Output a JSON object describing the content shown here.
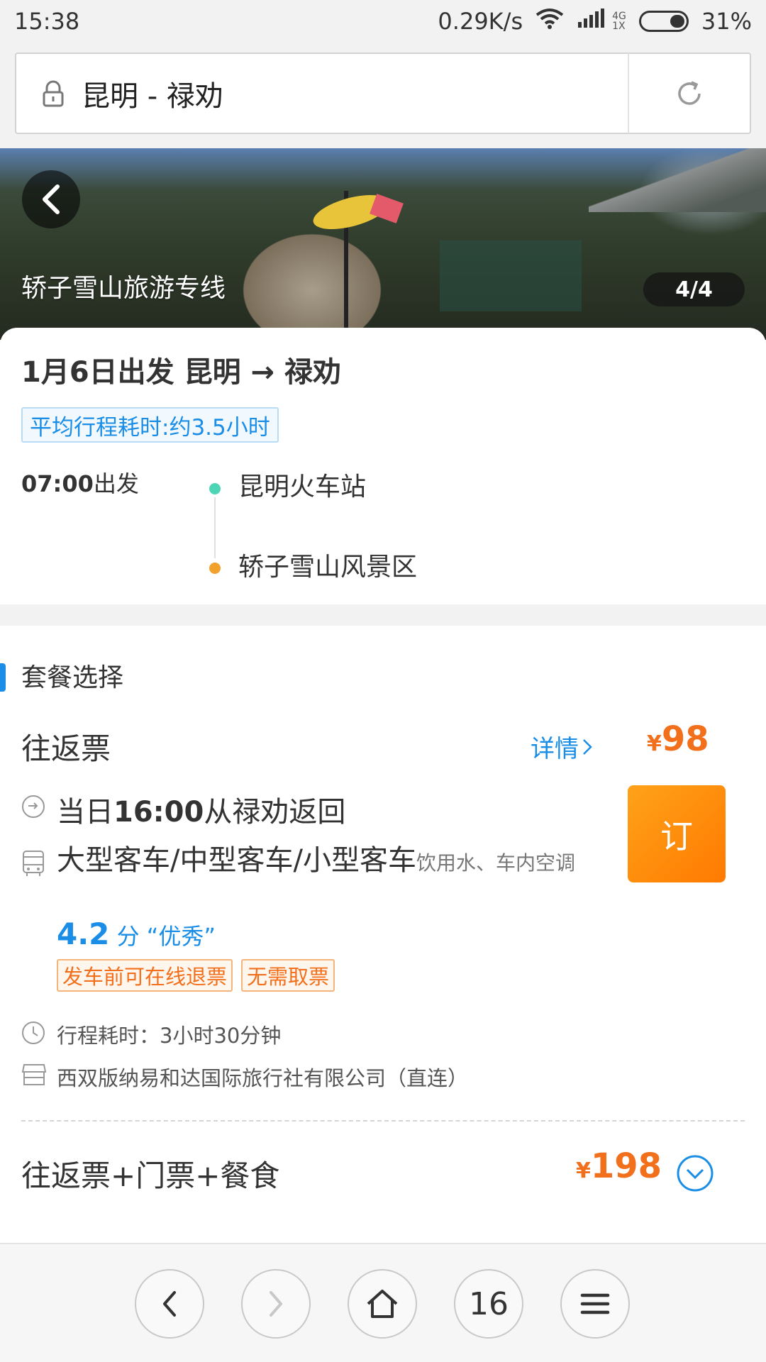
{
  "status_bar": {
    "time": "15:38",
    "network_speed": "0.29K/s",
    "signal_top": "4G",
    "signal_bottom": "1X",
    "battery": "31%"
  },
  "url_bar": {
    "title": "昆明 - 禄劝"
  },
  "hero": {
    "title": "轿子雪山旅游专线",
    "counter": "4/4"
  },
  "trip": {
    "title": "1月6日出发   昆明 → 禄劝",
    "avg_duration": "平均行程耗时:约3.5小时",
    "departure_time": "07:00",
    "departure_suffix": "出发",
    "from_stop": "昆明火车站",
    "to_stop": "轿子雪山风景区"
  },
  "packages": {
    "header": "套餐选择",
    "option1": {
      "name": "往返票",
      "detail_label": "详情",
      "currency": "¥",
      "price": "98",
      "book_label": "订",
      "return_prefix": "当日",
      "return_time": "16:00",
      "return_suffix": "从禄劝返回",
      "vehicle_types": "大型客车/中型客车/小型客车",
      "amenities": "饮用水、车内空调",
      "rating_score": "4.2",
      "rating_unit": "分",
      "rating_label": "“优秀”",
      "tags": [
        "发车前可在线退票",
        "无需取票"
      ],
      "duration": "行程耗时：3小时30分钟",
      "operator": "西双版纳易和达国际旅行社有限公司（直连）"
    },
    "option2": {
      "name": "往返票+门票+餐食",
      "currency": "¥",
      "price": "198"
    }
  },
  "bottom_nav": {
    "tab_count": "16"
  },
  "colors": {
    "accent_blue": "#1a8ee6",
    "price_orange": "#f26f1b",
    "book_button": "#ff8a00",
    "start_dot": "#4dd6b6",
    "end_dot": "#f2a12c"
  }
}
